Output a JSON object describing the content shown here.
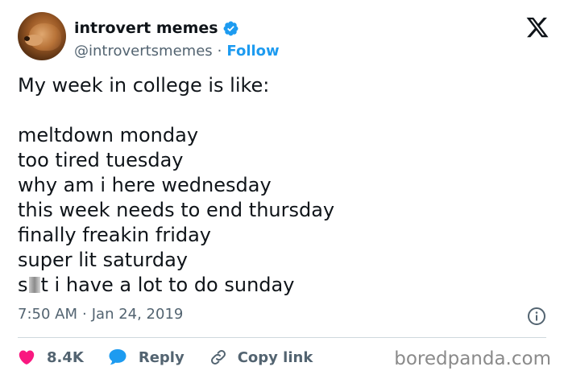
{
  "author": {
    "display_name": "introvert memes",
    "handle": "@introvertsmemes",
    "separator": "·",
    "follow_label": "Follow"
  },
  "tweet": {
    "intro": "My week in college is like:",
    "lines": [
      "meltdown monday",
      "too tired tuesday",
      "why am i here wednesday",
      "this week needs to end thursday",
      "finally freakin friday",
      "super lit saturday"
    ],
    "last_line_prefix": "s",
    "last_line_suffix": "t i have a lot to do sunday"
  },
  "meta": {
    "time": "7:50 AM",
    "separator": "·",
    "date": "Jan 24, 2019"
  },
  "actions": {
    "like_count": "8.4K",
    "reply_label": "Reply",
    "copy_link_label": "Copy link"
  },
  "watermark": "boredpanda.com",
  "colors": {
    "accent": "#1d9bf0",
    "like": "#f91880",
    "muted": "#536471",
    "text": "#0f1419"
  },
  "icons": {
    "verified": "verified-badge-icon",
    "platform": "x-logo-icon",
    "info": "info-icon",
    "like": "heart-icon",
    "reply": "speech-bubble-icon",
    "copy": "link-icon"
  }
}
